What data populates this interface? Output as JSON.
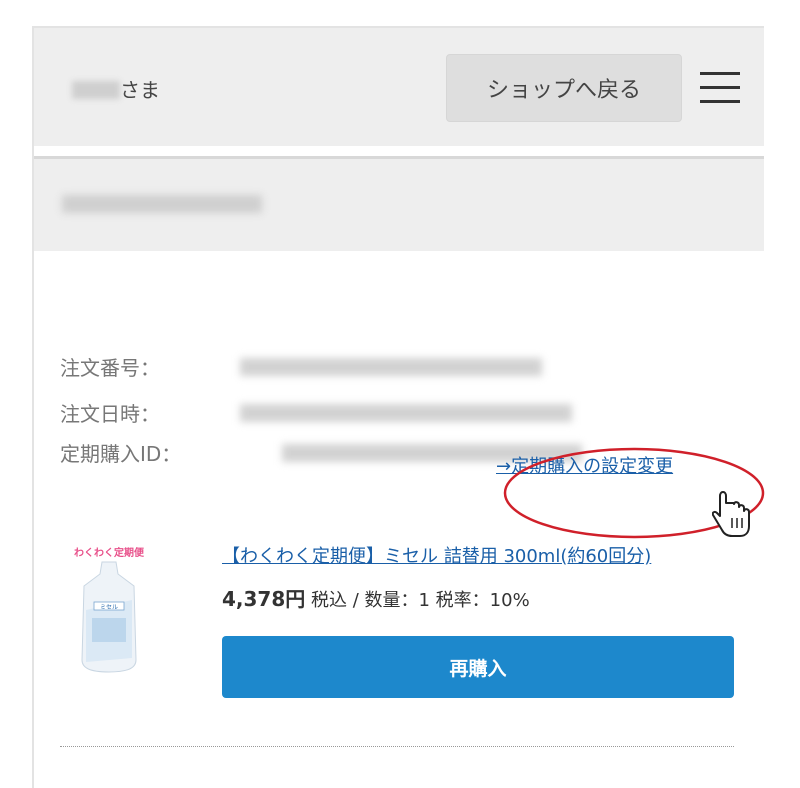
{
  "header": {
    "user_suffix": "さま",
    "shop_button_label": "ショップへ戻る",
    "menu_icon": "hamburger-menu-icon"
  },
  "order": {
    "number_label": "注文番号：",
    "datetime_label": "注文日時：",
    "subscription_id_label": "定期購入ID："
  },
  "subscription_link": "→定期購入の設定変更",
  "product": {
    "title": "【わくわく定期便】ミセル 詰替用 300ml(約60回分)",
    "price": "4,378円",
    "price_detail": " 税込 / 数量：1 税率：10%",
    "thumbnail_banner": "わくわく定期便",
    "thumbnail_pack_label": "ミセル"
  },
  "rebuy_button_label": "再購入",
  "colors": {
    "accent_button": "#1d88cc",
    "link": "#1a5fa8",
    "highlight_ring": "#d0202a"
  }
}
